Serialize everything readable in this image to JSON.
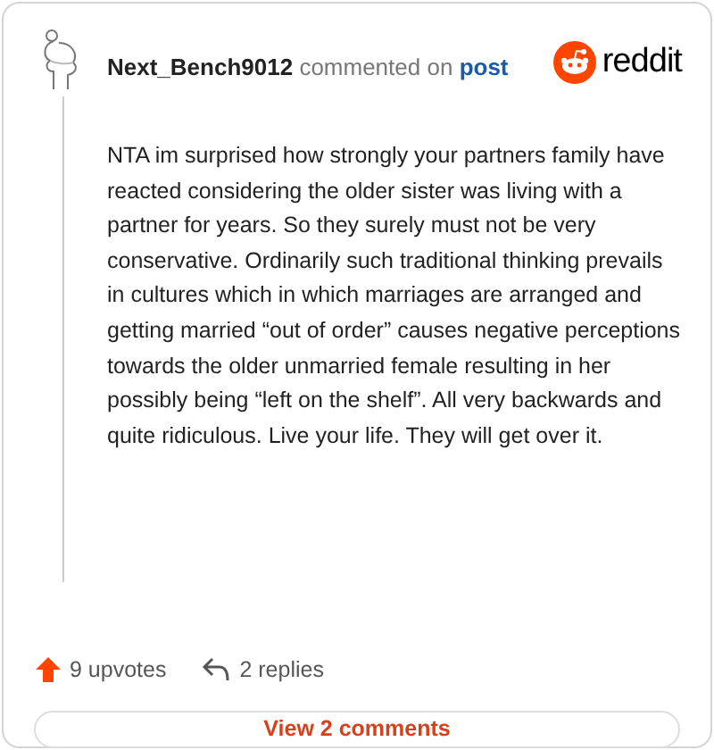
{
  "comment": {
    "author": "Next_Bench9012",
    "action": "commented on",
    "link": "post",
    "brand": "reddit",
    "body": "NTA im surprised how strongly your partners family have reacted considering the older sister was living with a partner for years. So they surely must not be very conservative. Ordinarily such traditional thinking prevails in cultures which in which marriages are arranged and getting married “out of order” causes negative perceptions towards the older unmarried female resulting in her possibly being “left on the shelf”. All very backwards and quite ridiculous. Live your life. They will get over it.",
    "upvotes": "9 upvotes",
    "replies": "2 replies",
    "button": "View 2 comments"
  }
}
